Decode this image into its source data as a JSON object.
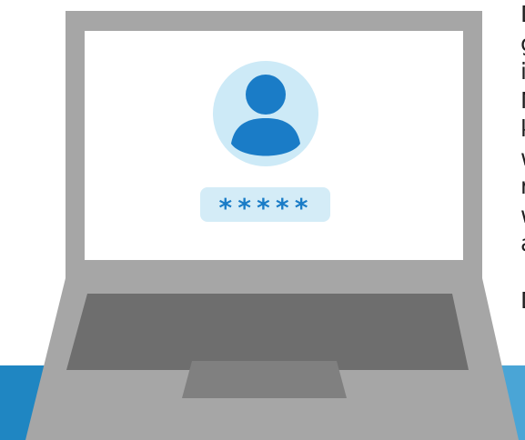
{
  "colors": {
    "laptop_body": "#a6a6a6",
    "screen_bg": "#ffffff",
    "avatar_bg": "#cdeaf7",
    "avatar_fg": "#1a7cc7",
    "password_pill": "#d4ecf7",
    "password_chars": "#1a7cc7",
    "keyboard": "#6e6e6e",
    "trackpad": "#7f7f7f",
    "base_band": "#1f86c2",
    "text": "#1f1f1f"
  },
  "login": {
    "avatar_icon": "user-avatar-icon",
    "password_mask": "*****"
  },
  "side_text": {
    "lines_para1": [
      "D",
      "g",
      "i",
      "N",
      "k",
      "w",
      "n",
      "w",
      "a"
    ],
    "lines_para2": [
      "D"
    ]
  }
}
